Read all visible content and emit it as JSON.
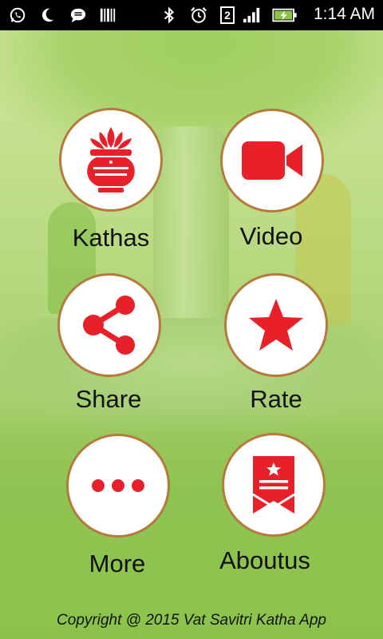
{
  "status_bar": {
    "time": "1:14 AM",
    "sim_number": "2",
    "icons": [
      "whatsapp-icon",
      "moon-icon",
      "message-icon",
      "barcode-icon",
      "bluetooth-icon",
      "alarm-icon",
      "sim-icon",
      "signal-icon",
      "battery-charging-icon"
    ]
  },
  "menu": {
    "kathas": {
      "label": "Kathas",
      "icon": "kalash-icon"
    },
    "video": {
      "label": "Video",
      "icon": "video-camera-icon"
    },
    "share": {
      "label": "Share",
      "icon": "share-icon"
    },
    "rate": {
      "label": "Rate",
      "icon": "star-icon"
    },
    "more": {
      "label": "More",
      "icon": "more-dots-icon"
    },
    "aboutus": {
      "label": "Aboutus",
      "icon": "about-bookmark-icon"
    }
  },
  "footer": {
    "copyright": "Copyright @ 2015 Vat Savitri Katha App"
  },
  "colors": {
    "accent": "#e8202a",
    "ring": "#b57a3c",
    "background": "#8bc34a"
  }
}
